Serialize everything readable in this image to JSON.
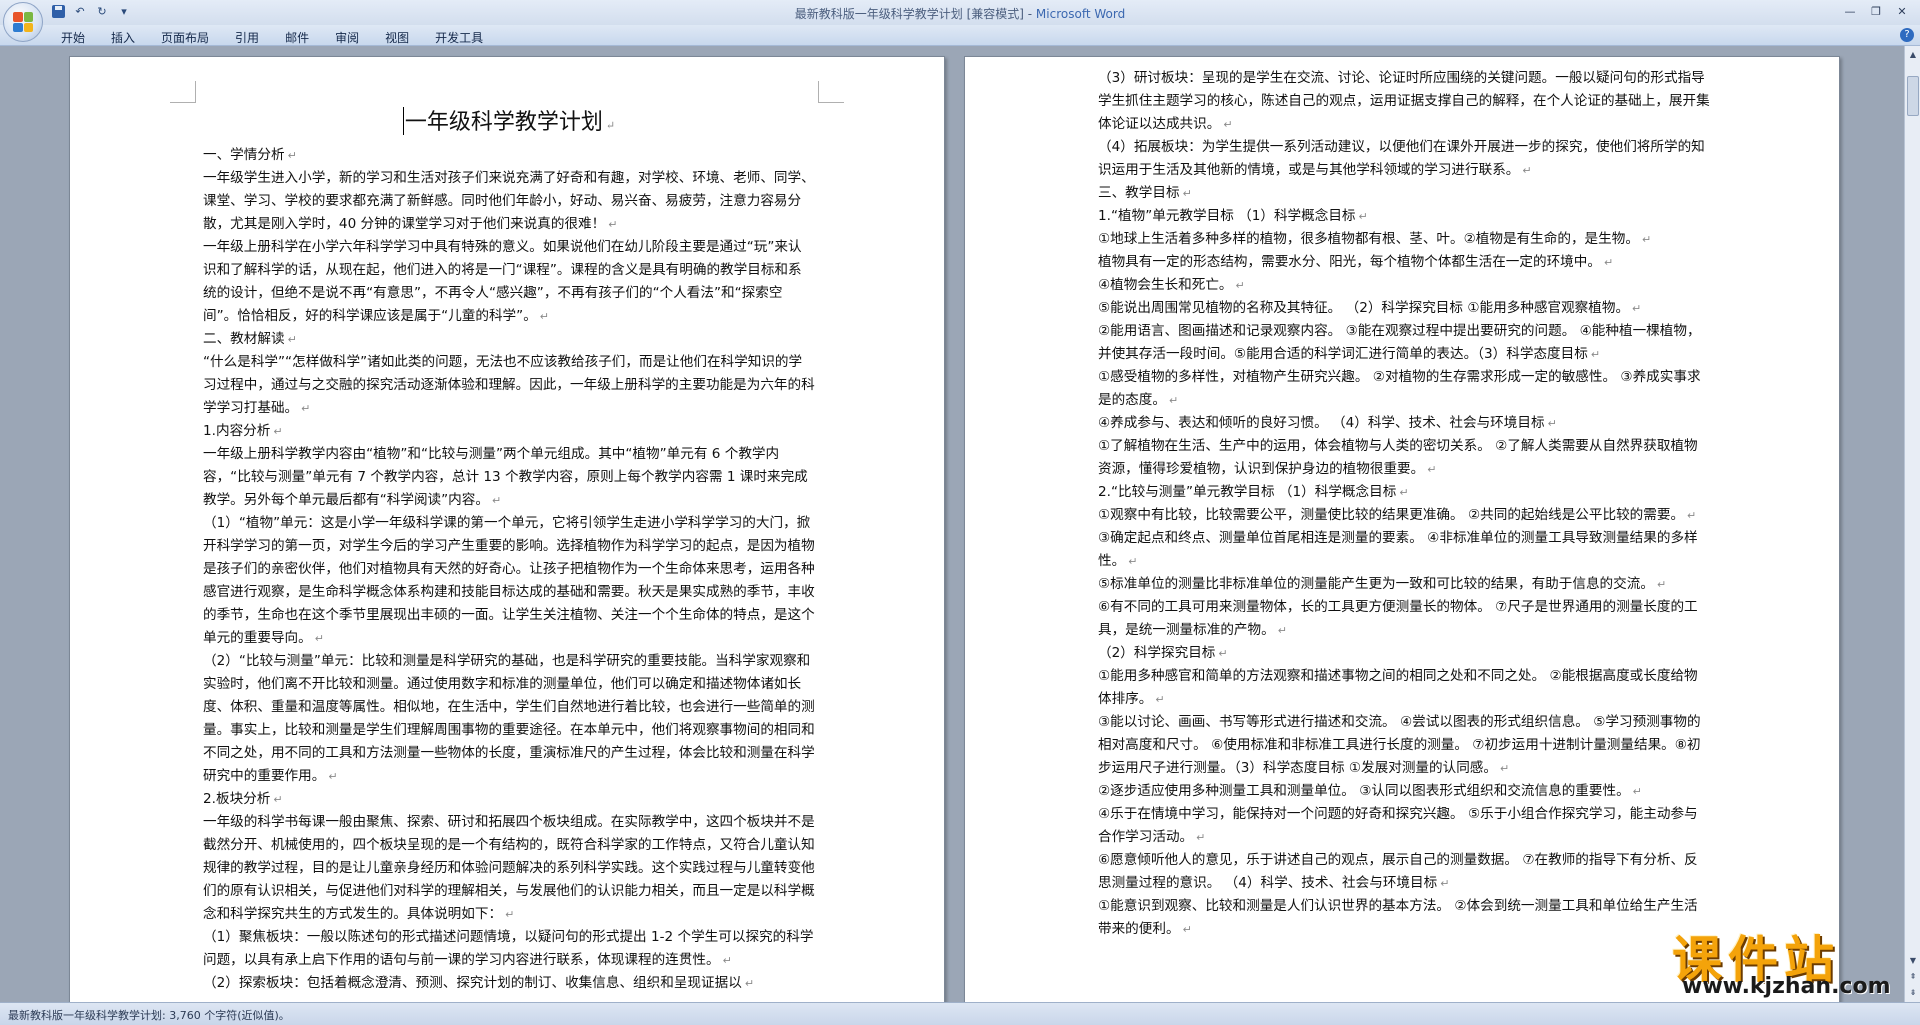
{
  "window": {
    "title": "最新教科版一年级科学教学计划 [兼容模式] - ",
    "app_name": "Microsoft Word"
  },
  "quick_access": {
    "icons": [
      "save-icon",
      "undo-icon",
      "redo-icon",
      "customize-icon"
    ]
  },
  "ribbon": {
    "tabs": [
      "开始",
      "插入",
      "页面布局",
      "引用",
      "邮件",
      "审阅",
      "视图",
      "开发工具"
    ]
  },
  "document": {
    "title": "一年级科学教学计划",
    "left_paragraphs": [
      "一、学情分析",
      "一年级学生进入小学，新的学习和生活对孩子们来说充满了好奇和有趣，对学校、环境、老师、同学、课堂、学习、学校的要求都充满了新鲜感。同时他们年龄小，好动、易兴奋、易疲劳，注意力容易分散，尤其是刚入学时，40 分钟的课堂学习对于他们来说真的很难！",
      "一年级上册科学在小学六年科学学习中具有特殊的意义。如果说他们在幼儿阶段主要是通过“玩”来认识和了解科学的话，从现在起，他们进入的将是一门“课程”。课程的含义是具有明确的教学目标和系统的设计，但绝不是说不再“有意思”，不再令人“感兴趣”，不再有孩子们的“个人看法”和“探索空间”。恰恰相反，好的科学课应该是属于“儿童的科学”。",
      "二、教材解读",
      "“什么是科学”“怎样做科学”诸如此类的问题，无法也不应该教给孩子们，而是让他们在科学知识的学习过程中，通过与之交融的探究活动逐渐体验和理解。因此，一年级上册科学的主要功能是为六年的科学学习打基础。",
      "1.内容分析",
      "一年级上册科学教学内容由“植物”和“比较与测量”两个单元组成。其中“植物”单元有 6 个教学内容，“比较与测量”单元有 7 个教学内容，总计 13 个教学内容，原则上每个教学内容需 1 课时来完成教学。另外每个单元最后都有“科学阅读”内容。",
      "（1）“植物”单元：这是小学一年级科学课的第一个单元，它将引领学生走进小学科学学习的大门，掀开科学学习的第一页，对学生今后的学习产生重要的影响。选择植物作为科学学习的起点，是因为植物是孩子们的亲密伙伴，他们对植物具有天然的好奇心。让孩子把植物作为一个生命体来思考，运用各种感官进行观察，是生命科学概念体系构建和技能目标达成的基础和需要。秋天是果实成熟的季节，丰收的季节，生命也在这个季节里展现出丰硕的一面。让学生关注植物、关注一个个生命体的特点，是这个单元的重要导向。",
      "（2）“比较与测量”单元：比较和测量是科学研究的基础，也是科学研究的重要技能。当科学家观察和实验时，他们离不开比较和测量。通过使用数字和标准的测量单位，他们可以确定和描述物体诸如长度、体积、重量和温度等属性。相似地，在生活中，学生们自然地进行着比较，也会进行一些简单的测量。事实上，比较和测量是学生们理解周围事物的重要途径。在本单元中，他们将观察事物间的相同和不同之处，用不同的工具和方法测量一些物体的长度，重演标准尺的产生过程，体会比较和测量在科学研究中的重要作用。",
      "2.板块分析",
      "一年级的科学书每课一般由聚焦、探索、研讨和拓展四个板块组成。在实际教学中，这四个板块并不是截然分开、机械使用的，四个板块呈现的是一个有结构的，既符合科学家的工作特点，又符合儿童认知规律的教学过程，目的是让儿童亲身经历和体验问题解决的系列科学实践。这个实践过程与儿童转变他们的原有认识相关，与促进他们对科学的理解相关，与发展他们的认识能力相关，而且一定是以科学概念和科学探究共生的方式发生的。具体说明如下：",
      "（1）聚焦板块：一般以陈述句的形式描述问题情境，以疑问句的形式提出 1-2 个学生可以探究的科学问题，以具有承上启下作用的语句与前一课的学习内容进行联系，体现课程的连贯性。",
      "（2）探索板块：包括着概念澄清、预测、探究计划的制订、收集信息、组织和呈现证据以"
    ],
    "right_paragraphs": [
      "（3）研讨板块：呈现的是学生在交流、讨论、论证时所应围绕的关键问题。一般以疑问句的形式指导学生抓住主题学习的核心，陈述自己的观点，运用证据支撑自己的解释，在个人论证的基础上，展开集体论证以达成共识。",
      "（4）拓展板块：为学生提供一系列活动建议，以便他们在课外开展进一步的探究，使他们将所学的知识运用于生活及其他新的情境，或是与其他学科领域的学习进行联系。",
      "三、教学目标",
      "1.“植物”单元教学目标 （1）科学概念目标",
      "①地球上生活着多种多样的植物，很多植物都有根、茎、叶。②植物是有生命的，是生物。",
      "植物具有一定的形态结构，需要水分、阳光，每个植物个体都生活在一定的环境中。",
      "④植物会生长和死亡。",
      "⑤能说出周围常见植物的名称及其特征。 （2）科学探究目标 ①能用多种感官观察植物。",
      "②能用语言、图画描述和记录观察内容。 ③能在观察过程中提出要研究的问题。 ④能种植一棵植物，并使其存活一段时间。⑤能用合适的科学词汇进行简单的表达。（3）科学态度目标",
      "①感受植物的多样性，对植物产生研究兴趣。 ②对植物的生存需求形成一定的敏感性。 ③养成实事求是的态度。",
      "④养成参与、表达和倾听的良好习惯。 （4）科学、技术、社会与环境目标",
      "①了解植物在生活、生产中的运用，体会植物与人类的密切关系。 ②了解人类需要从自然界获取植物资源，懂得珍爱植物，认识到保护身边的植物很重要。",
      "2.“比较与测量”单元教学目标 （1）科学概念目标",
      "①观察中有比较，比较需要公平，测量使比较的结果更准确。 ②共同的起始线是公平比较的需要。",
      "③确定起点和终点、测量单位首尾相连是测量的要素。 ④非标准单位的测量工具导致测量结果的多样性。",
      "⑤标准单位的测量比非标准单位的测量能产生更为一致和可比较的结果，有助于信息的交流。",
      "⑥有不同的工具可用来测量物体，长的工具更方便测量长的物体。 ⑦尺子是世界通用的测量长度的工具，是统一测量标准的产物。",
      "（2）科学探究目标",
      "①能用多种感官和简单的方法观察和描述事物之间的相同之处和不同之处。 ②能根据高度或长度给物体排序。",
      "③能以讨论、画画、书写等形式进行描述和交流。 ④尝试以图表的形式组织信息。 ⑤学习预测事物的相对高度和尺寸。 ⑥使用标准和非标准工具进行长度的测量。 ⑦初步运用十进制计量测量结果。⑧初步运用尺子进行测量。（3）科学态度目标 ①发展对测量的认同感。",
      "②逐步适应使用多种测量工具和测量单位。 ③认同以图表形式组织和交流信息的重要性。",
      "④乐于在情境中学习，能保持对一个问题的好奇和探究兴趣。 ⑤乐于小组合作探究学习，能主动参与合作学习活动。",
      "⑥愿意倾听他人的意见，乐于讲述自己的观点，展示自己的测量数据。 ⑦在教师的指导下有分析、反思测量过程的意识。 （4）科学、技术、社会与环境目标",
      "①能意识到观察、比较和测量是人们认识世界的基本方法。 ②体会到统一测量工具和单位给生产生活带来的便利。"
    ]
  },
  "status_bar": {
    "text": "最新教科版一年级科学教学计划: 3,760 个字符(近似值)。"
  },
  "watermark": {
    "title": "课件站",
    "url": "www.kjzhan.com"
  },
  "colors": {
    "accent": "#3b68b0",
    "page_bg": "#ffffff",
    "workspace_bg": "#9ba6b6",
    "watermark_orange": "#f4a30a"
  }
}
